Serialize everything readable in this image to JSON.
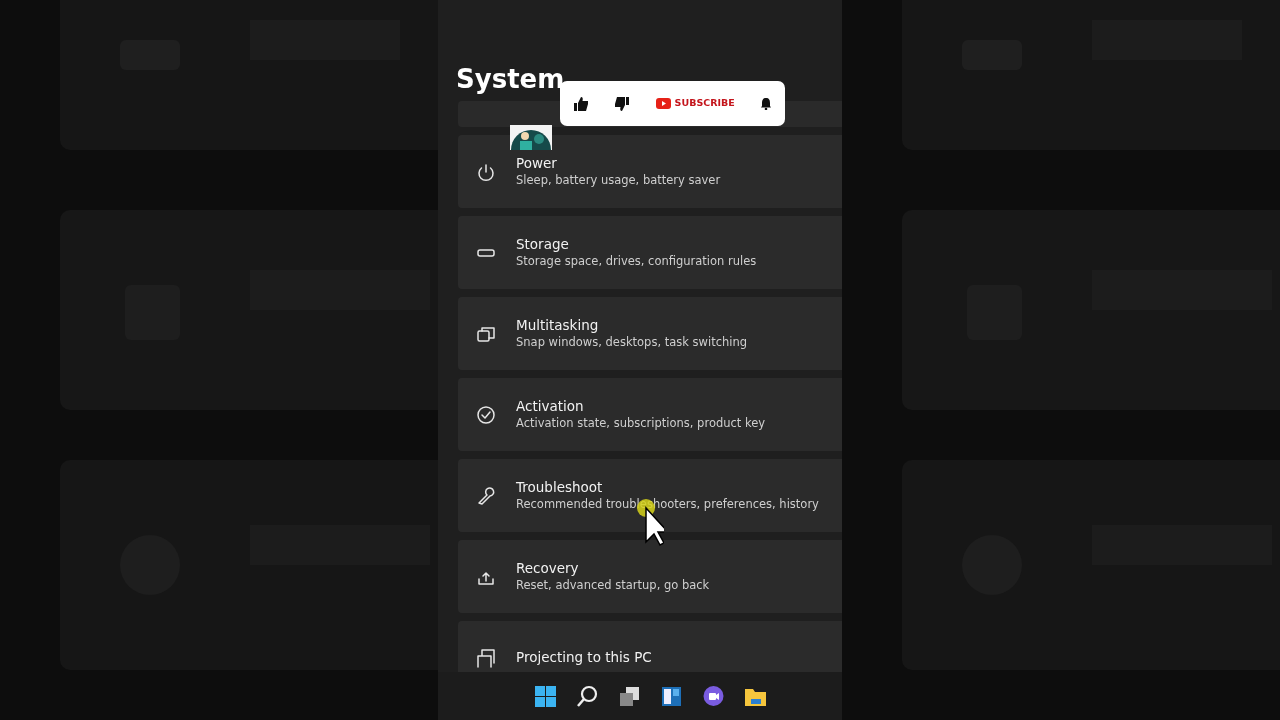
{
  "title": "System",
  "settings": [
    {
      "title": "Power",
      "subtitle": "Sleep, battery usage, battery saver"
    },
    {
      "title": "Storage",
      "subtitle": "Storage space, drives, configuration rules"
    },
    {
      "title": "Multitasking",
      "subtitle": "Snap windows, desktops, task switching"
    },
    {
      "title": "Activation",
      "subtitle": "Activation state, subscriptions, product key"
    },
    {
      "title": "Troubleshoot",
      "subtitle": "Recommended troubleshooters, preferences, history"
    },
    {
      "title": "Recovery",
      "subtitle": "Reset, advanced startup, go back"
    },
    {
      "title": "Projecting to this PC"
    }
  ],
  "overlay": {
    "subscribe": "SUBSCRIBE"
  }
}
